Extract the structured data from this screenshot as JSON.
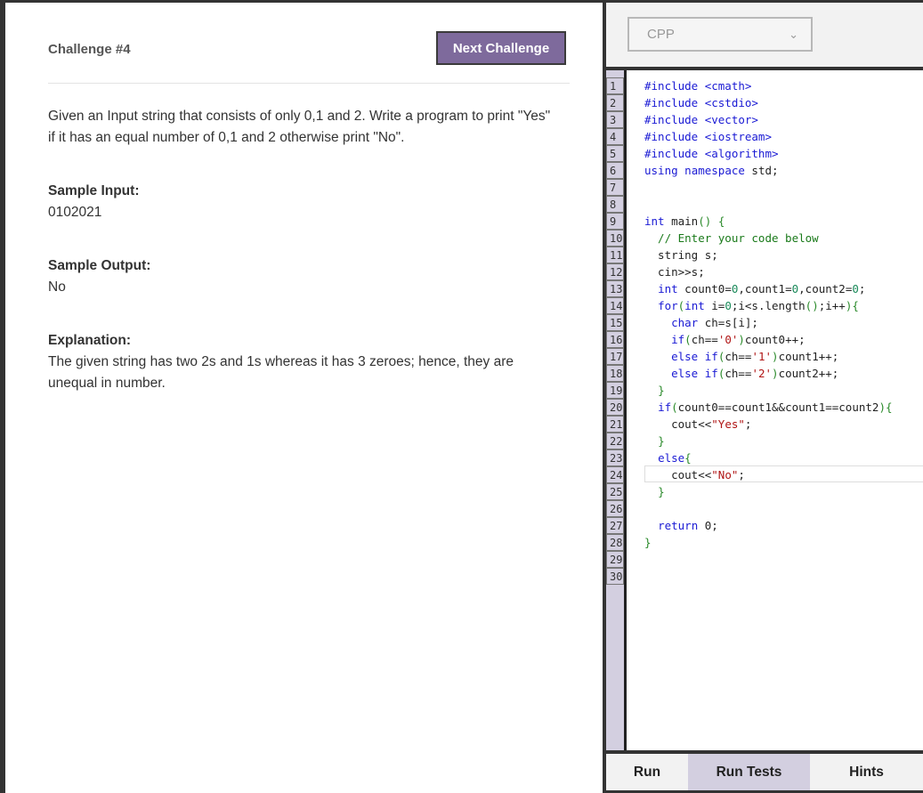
{
  "challenge": {
    "title": "Challenge #4",
    "next_button": "Next Challenge",
    "description_line1": "Given an Input string that consists of only 0,1 and 2. Write a program to print \"Yes\"",
    "description_line2": "if it has an equal number of 0,1 and 2 otherwise print \"No\".",
    "sample_input_label": "Sample Input:",
    "sample_input_value": "0102021",
    "sample_output_label": "Sample Output:",
    "sample_output_value": "No",
    "explanation_label": "Explanation:",
    "explanation_line1": "The given string has two 2s and 1s whereas it has 3 zeroes; hence, they are",
    "explanation_line2": "unequal in number."
  },
  "editor": {
    "language": "CPP",
    "line_numbers": [
      "1",
      "2",
      "3",
      "4",
      "5",
      "6",
      "7",
      "8",
      "9",
      "10",
      "11",
      "12",
      "13",
      "14",
      "15",
      "16",
      "17",
      "18",
      "19",
      "20",
      "21",
      "22",
      "23",
      "24",
      "25",
      "26",
      "27",
      "28",
      "29",
      "30"
    ],
    "code": [
      "#include <cmath>",
      "#include <cstdio>",
      "#include <vector>",
      "#include <iostream>",
      "#include <algorithm>",
      "using namespace std;",
      "",
      "",
      "int main() {",
      "  // Enter your code below",
      "  string s;",
      "  cin>>s;",
      "  int count0=0,count1=0,count2=0;",
      "  for(int i=0;i<s.length();i++){",
      "    char ch=s[i];",
      "    if(ch=='0')count0++;",
      "    else if(ch=='1')count1++;",
      "    else if(ch=='2')count2++;",
      "  }",
      "  if(count0==count1&&count1==count2){",
      "    cout<<\"Yes\";",
      "  }",
      "  else{",
      "    cout<<\"No\";",
      "  }",
      "",
      "  return 0;",
      "}",
      "",
      ""
    ]
  },
  "tabs": {
    "run": "Run",
    "run_tests": "Run Tests",
    "hints": "Hints"
  }
}
